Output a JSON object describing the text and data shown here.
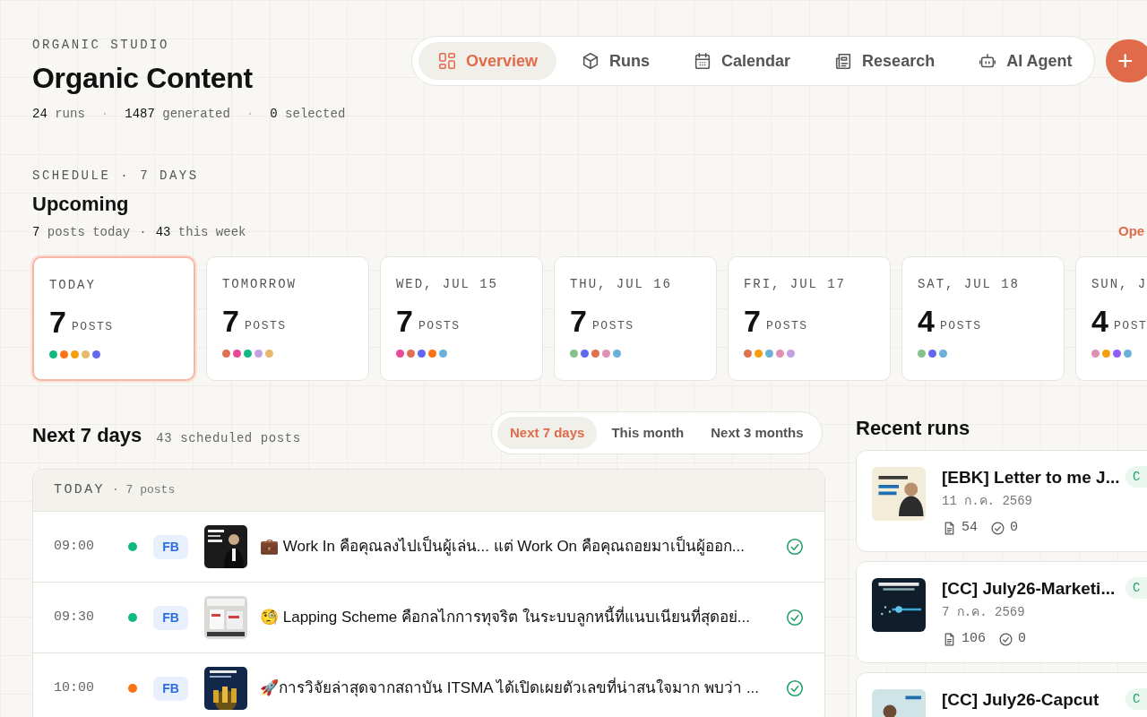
{
  "header": {
    "eyebrow": "ORGANIC STUDIO",
    "title": "Organic Content",
    "separator": "·",
    "stats": [
      {
        "value": "24",
        "label": "runs"
      },
      {
        "value": "1487",
        "label": "generated"
      },
      {
        "value": "0",
        "label": "selected"
      }
    ]
  },
  "nav": {
    "tabs": [
      {
        "label": "Overview",
        "selected": true
      },
      {
        "label": "Runs",
        "selected": false
      },
      {
        "label": "Calendar",
        "selected": false
      },
      {
        "label": "Research",
        "selected": false
      },
      {
        "label": "AI Agent",
        "selected": false
      }
    ],
    "add_button": "+"
  },
  "schedule": {
    "eyebrow": "SCHEDULE · 7 DAYS",
    "title": "Upcoming",
    "separator": "·",
    "summary": [
      {
        "value": "7",
        "label": "posts today"
      },
      {
        "value": "43",
        "label": "this week"
      }
    ],
    "link": "Ope",
    "days": [
      {
        "label": "TODAY",
        "count": "7",
        "unit": "POSTS",
        "selected": true,
        "dots": [
          {
            "color": "#10b981"
          },
          {
            "color": "#f97316"
          },
          {
            "color": "#f59e0b"
          },
          {
            "color": "#e8b86a"
          },
          {
            "color": "#6366f1"
          }
        ]
      },
      {
        "label": "TOMORROW",
        "count": "7",
        "unit": "POSTS",
        "selected": false,
        "dots": [
          {
            "color": "#e07050"
          },
          {
            "color": "#ec4899"
          },
          {
            "color": "#10b981"
          },
          {
            "color": "#c4a0e0"
          },
          {
            "color": "#e8b86a"
          }
        ]
      },
      {
        "label": "WED, JUL 15",
        "count": "7",
        "unit": "POSTS",
        "selected": false,
        "dots": [
          {
            "color": "#ec4899"
          },
          {
            "color": "#e07050"
          },
          {
            "color": "#6366f1"
          },
          {
            "color": "#f97316"
          },
          {
            "color": "#6bb0d8"
          }
        ]
      },
      {
        "label": "THU, JUL 16",
        "count": "7",
        "unit": "POSTS",
        "selected": false,
        "dots": [
          {
            "color": "#86c08a"
          },
          {
            "color": "#6366f1"
          },
          {
            "color": "#e07050"
          },
          {
            "color": "#e090b0"
          },
          {
            "color": "#6bb0d8"
          }
        ]
      },
      {
        "label": "FRI, JUL 17",
        "count": "7",
        "unit": "POSTS",
        "selected": false,
        "dots": [
          {
            "color": "#e07050"
          },
          {
            "color": "#f59e0b"
          },
          {
            "color": "#6bb0d8"
          },
          {
            "color": "#e090b0"
          },
          {
            "color": "#c4a0e0"
          }
        ]
      },
      {
        "label": "SAT, JUL 18",
        "count": "4",
        "unit": "POSTS",
        "selected": false,
        "dots": [
          {
            "color": "#86c08a"
          },
          {
            "color": "#6366f1"
          },
          {
            "color": "#6bb0d8"
          }
        ]
      },
      {
        "label": "SUN, J",
        "count": "4",
        "unit": "POST",
        "selected": false,
        "dots": [
          {
            "color": "#e090b0"
          },
          {
            "color": "#f59e0b"
          },
          {
            "color": "#8b5cf6"
          },
          {
            "color": "#6bb0d8"
          }
        ]
      }
    ]
  },
  "upcoming_list": {
    "title": "Next 7 days",
    "subtitle": "43 scheduled posts",
    "ranges": [
      {
        "label": "Next 7 days",
        "selected": true
      },
      {
        "label": "This month",
        "selected": false
      },
      {
        "label": "Next 3 months",
        "selected": false
      }
    ],
    "groups": [
      {
        "label": "TODAY",
        "count": "· 7 posts",
        "posts": [
          {
            "time": "09:00",
            "color": "#10b981",
            "platform": "FB",
            "text": "💼 Work In คือคุณลงไปเป็นผู้เล่น... แต่ Work On คือคุณถอยมาเป็นผู้ออก...",
            "approved": true
          },
          {
            "time": "09:30",
            "color": "#10b981",
            "platform": "FB",
            "text": "🧐 Lapping Scheme คือกลไกการทุจริต ในระบบลูกหนี้ที่แนบเนียนที่สุดอย่...",
            "approved": true
          },
          {
            "time": "10:00",
            "color": "#f97316",
            "platform": "FB",
            "text": "🚀การวิจัยล่าสุดจากสถาบัน ITSMA ได้เปิดเผยตัวเลขที่น่าสนใจมาก พบว่า ...",
            "approved": true
          }
        ]
      }
    ]
  },
  "recent_runs": {
    "title": "Recent runs",
    "runs": [
      {
        "title": "[EBK] Letter to me J...",
        "date": "11 ก.ค. 2569",
        "posts": "54",
        "approved": "0",
        "badge": "C"
      },
      {
        "title": "[CC] July26-Marketi...",
        "date": "7 ก.ค. 2569",
        "posts": "106",
        "approved": "0",
        "badge": "C"
      },
      {
        "title": "[CC] July26-Capcut",
        "badge": "C"
      }
    ]
  }
}
